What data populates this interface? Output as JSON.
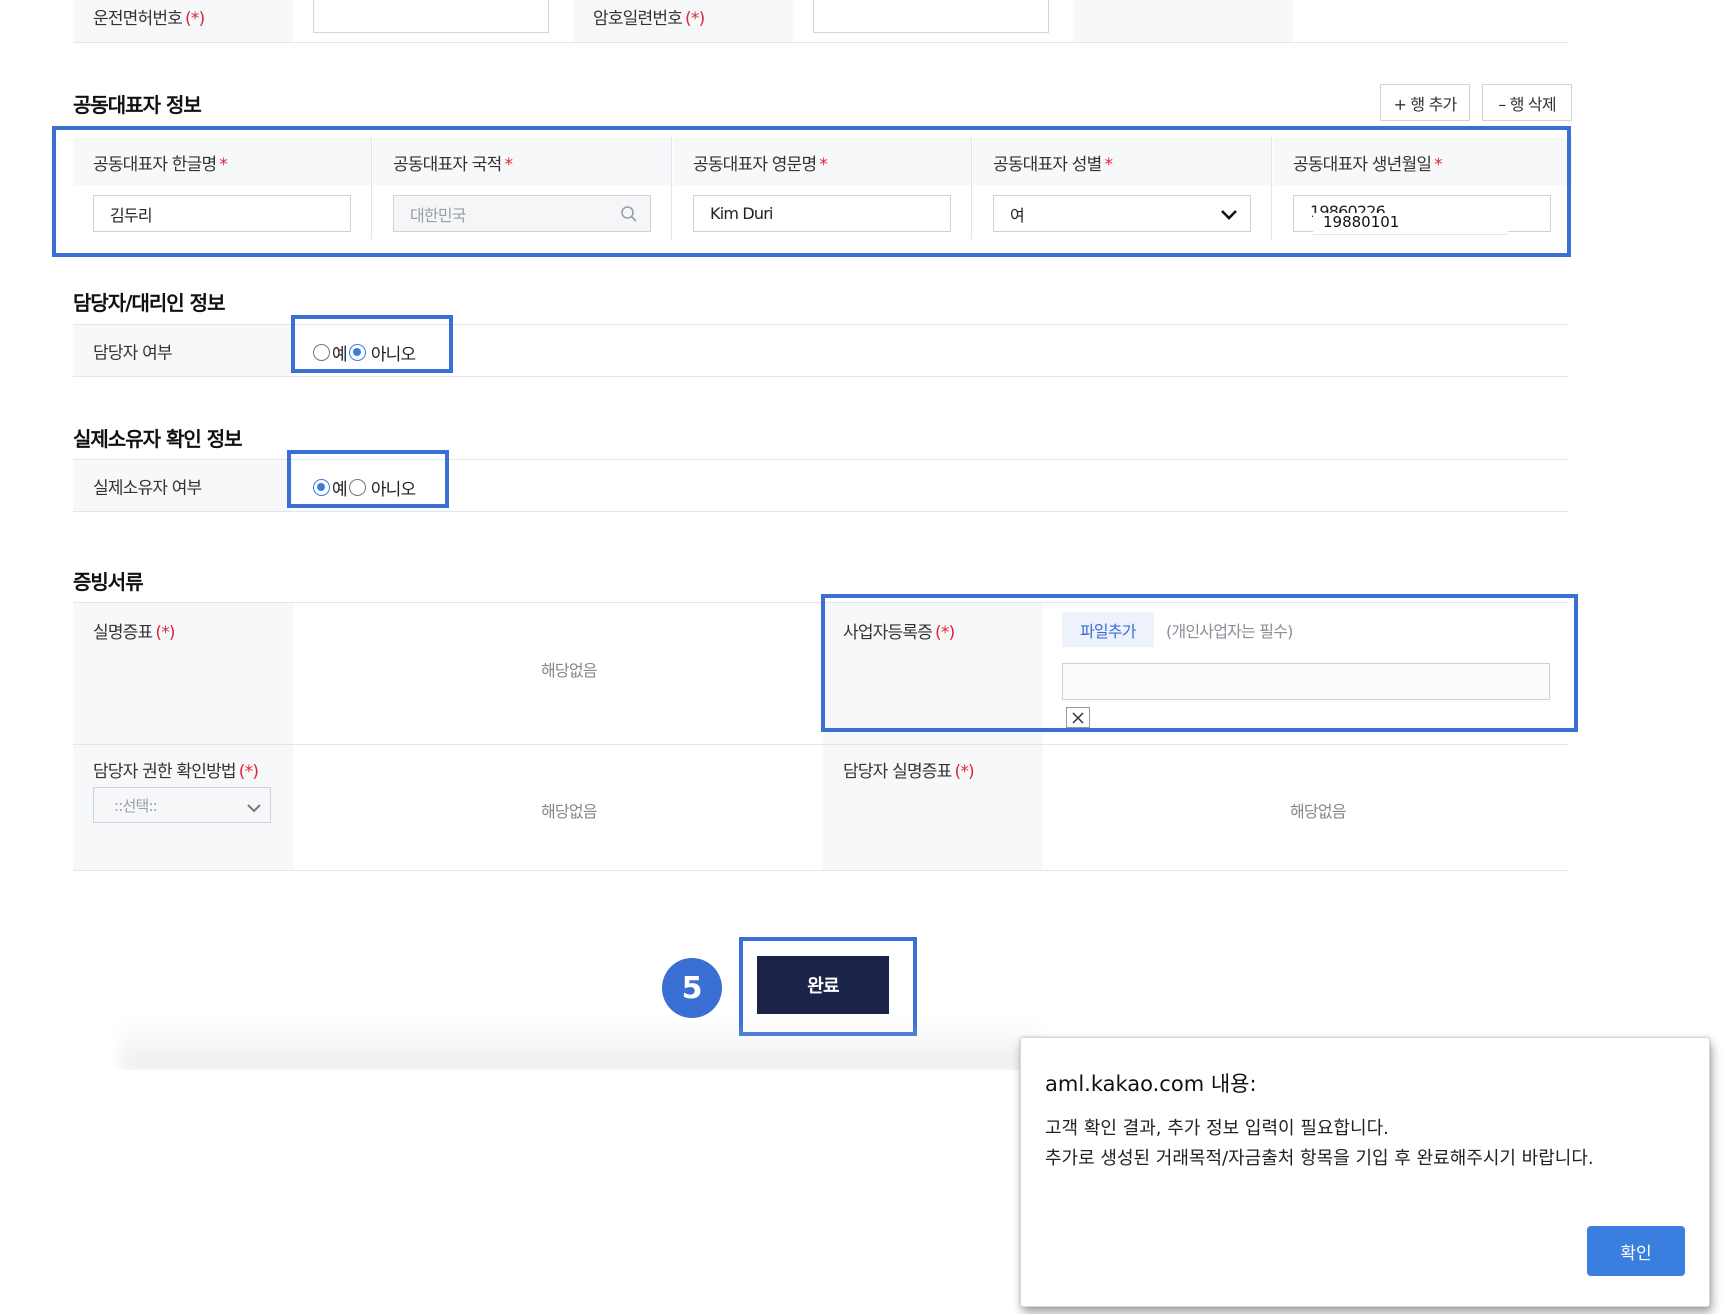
{
  "license_row": {
    "license_no_label": "운전면허번호",
    "serial_no_label": "암호일련번호",
    "required_mark": "(*)"
  },
  "co_rep": {
    "title": "공동대표자 정보",
    "add_row": "+ 행 추가",
    "delete_row": "– 행 삭제",
    "required_star": "*",
    "columns": [
      {
        "label": "공동대표자 한글명",
        "value": "김두리"
      },
      {
        "label": "공동대표자 국적",
        "value": "대한민국"
      },
      {
        "label": "공동대표자 영문명",
        "value": "Kim Duri"
      },
      {
        "label": "공동대표자 성별",
        "value": "여"
      },
      {
        "label": "공동대표자 생년월일",
        "value": "19860226"
      }
    ],
    "autocomplete_suggestion": "19880101"
  },
  "agent": {
    "title": "담당자/대리인 정보",
    "row_label": "담당자 여부",
    "options": [
      "예",
      "아니오"
    ],
    "selected": "아니오"
  },
  "owner": {
    "title": "실제소유자 확인 정보",
    "row_label": "실제소유자 여부",
    "options": [
      "예",
      "아니오"
    ],
    "selected": "예"
  },
  "docs": {
    "title": "증빙서류",
    "required_mark": "(*)",
    "real_name_id_label": "실명증표",
    "real_name_id_value": "해당없음",
    "biz_reg_label": "사업자등록증",
    "add_file": "파일추가",
    "hint": "(개인사업자는 필수)",
    "auth_method_label": "담당자 권한 확인방법",
    "auth_method_select": "::선택::",
    "auth_method_value": "해당없음",
    "agent_id_label": "담당자 실명증표",
    "agent_id_value": "해당없음"
  },
  "footer": {
    "step": "5",
    "complete": "완료"
  },
  "dialog": {
    "title": "aml.kakao.com 내용:",
    "line1": "고객 확인 결과, 추가 정보 입력이 필요합니다.",
    "line2": "추가로 생성된 거래목적/자금출처 항목을 기입 후 완료해주시기 바랍니다.",
    "ok": "확인"
  },
  "colors": {
    "highlight": "#3a6fd4",
    "primary_dark": "#1b2448",
    "required": "#e0263a",
    "radio_checked": "#3a7fe0"
  }
}
